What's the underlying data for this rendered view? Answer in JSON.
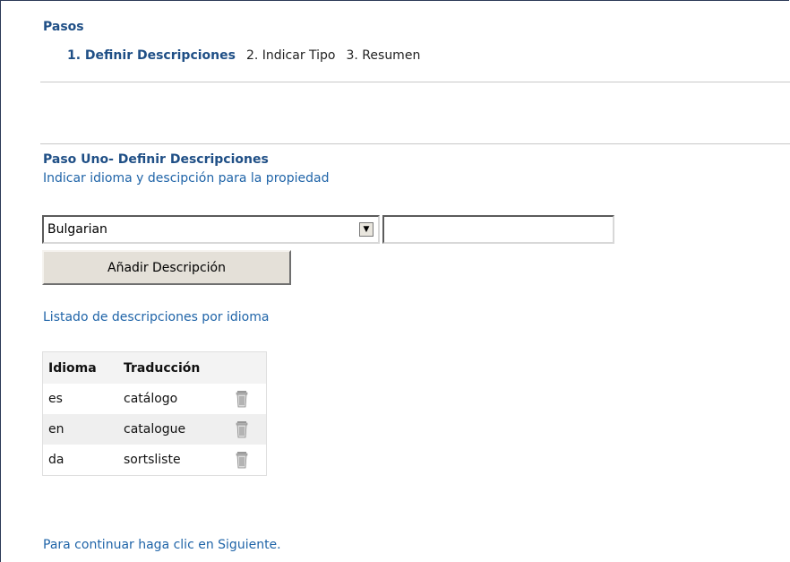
{
  "steps": {
    "title": "Pasos",
    "items": [
      {
        "label": "1. Definir Descripciones",
        "active": true
      },
      {
        "label": "2. Indicar Tipo",
        "active": false
      },
      {
        "label": "3. Resumen",
        "active": false
      }
    ]
  },
  "section": {
    "title": "Paso Uno- Definir Descripciones",
    "subtitle": "Indicar idioma y descipción para la propiedad"
  },
  "form": {
    "language_select_value": "Bulgarian",
    "description_input_value": "",
    "add_button_label": "Añadir Descripción"
  },
  "list": {
    "title": "Listado de descripciones por idioma",
    "columns": [
      "Idioma",
      "Traducción"
    ],
    "rows": [
      {
        "lang": "es",
        "translation": "catálogo",
        "action_icon": "trash-icon"
      },
      {
        "lang": "en",
        "translation": "catalogue",
        "action_icon": "trash-icon"
      },
      {
        "lang": "da",
        "translation": "sortsliste",
        "action_icon": "trash-icon"
      }
    ]
  },
  "footer": {
    "text": "Para continuar haga clic en Siguiente."
  },
  "colors": {
    "heading": "#1f4f86",
    "link_text": "#1f64a8",
    "button_face": "#e4e0d8",
    "row_alt": "#efefef"
  }
}
